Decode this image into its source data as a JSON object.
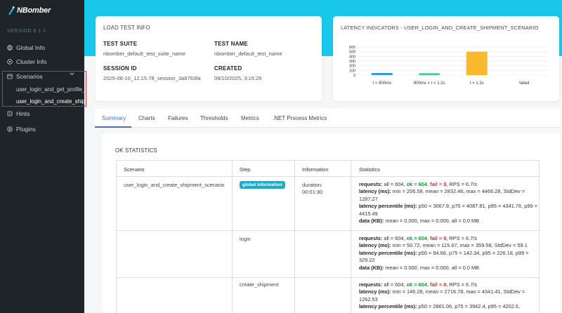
{
  "app": {
    "logo_text": "NBomber",
    "version": "VERSION 6.1.1"
  },
  "sidebar": {
    "items": [
      {
        "label": "Global Info",
        "icon": "globe-icon"
      },
      {
        "label": "Cluster Info",
        "icon": "cluster-icon"
      },
      {
        "label": "Scenarios",
        "icon": "scenarios-icon"
      },
      {
        "label": "Hints",
        "icon": "hints-icon"
      },
      {
        "label": "Plugins",
        "icon": "plugins-icon"
      }
    ],
    "scenarios": [
      "user_login_and_get_profile_scenario",
      "user_login_and_create_shipment_scenario"
    ]
  },
  "load_test_info": {
    "title": "LOAD TEST INFO",
    "test_suite_label": "TEST SUITE",
    "test_suite": "nbomber_default_test_suite_name",
    "test_name_label": "TEST NAME",
    "test_name": "nbomber_default_test_name",
    "session_id_label": "SESSION ID",
    "session_id": "2025-08-10_12.15.78_session_3a6763fa",
    "created_label": "CREATED",
    "created": "08/10/2025, 3:15:26"
  },
  "latency": {
    "title": "LATENCY INDICATORS - USER_LOGIN_AND_CREATE_SHIPMENT_SCENARIO"
  },
  "chart_data": {
    "type": "bar",
    "title": "LATENCY INDICATORS - USER_LOGIN_AND_CREATE_SHIPMENT_SCENARIO",
    "categories": [
      "t < 800ms",
      "800ms < t < 1.2s",
      "t > 1.2s",
      "failed"
    ],
    "values": [
      45,
      40,
      500,
      0
    ],
    "colors": [
      "#3a9ad9",
      "#3fcf8e",
      "#f9b82d",
      "#e05050"
    ],
    "ylim": [
      0,
      600
    ],
    "yticks": [
      "600",
      "500",
      "400",
      "300",
      "200",
      "100",
      "0"
    ],
    "grid": true
  },
  "tabs": [
    "Summary",
    "Charts",
    "Failures",
    "Thresholds",
    "Metrics",
    ".NET Process Metrics"
  ],
  "ok_stats": {
    "title": "OK STATISTICS",
    "columns": [
      "Scenario",
      "Step",
      "Information",
      "Statistics"
    ],
    "scenario_name": "user_login_and_create_shipment_scenario",
    "badge": "global information",
    "duration_label": "duration:",
    "duration": "00:01:30",
    "rows": [
      {
        "step": "",
        "req_label": "requests:",
        "req_all": "all = 604,",
        "req_ok": "ok = 604",
        "req_fail": "fail = 0",
        "req_rps": ", RPS = 6.7/s",
        "lat_label": "latency (ms):",
        "lat": "min = 206.58, mean = 2832.46, max = 4466.28, StdDev = 1287.27",
        "pct_label": "latency percentile (ms):",
        "pct": "p50 = 3067.9, p75 = 4087.81, p95 = 4341.76, p99 = 4415.49",
        "data_label": "data (KB):",
        "data": "mean = 0.000, max = 0.000, all = 0.0 MB"
      },
      {
        "step": "login",
        "req_label": "requests:",
        "req_all": "all = 604,",
        "req_ok": "ok = 604",
        "req_fail": "fail = 0",
        "req_rps": ", RPS = 6.7/s",
        "lat_label": "latency (ms):",
        "lat": "min = 50.72, mean = 115.67, max = 359.58, StdDev = 59.1",
        "pct_label": "latency percentile (ms):",
        "pct": "p50 = 94.66, p75 = 142.34, p95 = 226.18, p99 = 329.22",
        "data_label": "data (KB):",
        "data": "mean = 0.000, max = 0.000, all = 0.0 MB"
      },
      {
        "step": "create_shipment",
        "req_label": "requests:",
        "req_all": "all = 604,",
        "req_ok": "ok = 604",
        "req_fail": "fail = 0",
        "req_rps": ", RPS = 6.7/s",
        "lat_label": "latency (ms):",
        "lat": "min = 146.28, mean = 2716.78, max = 4341.41, StdDev = 1262.53",
        "pct_label": "latency percentile (ms):",
        "pct": "p50 = 2861.06, p75 = 3942.4, p95 = 4202.5,"
      }
    ]
  }
}
